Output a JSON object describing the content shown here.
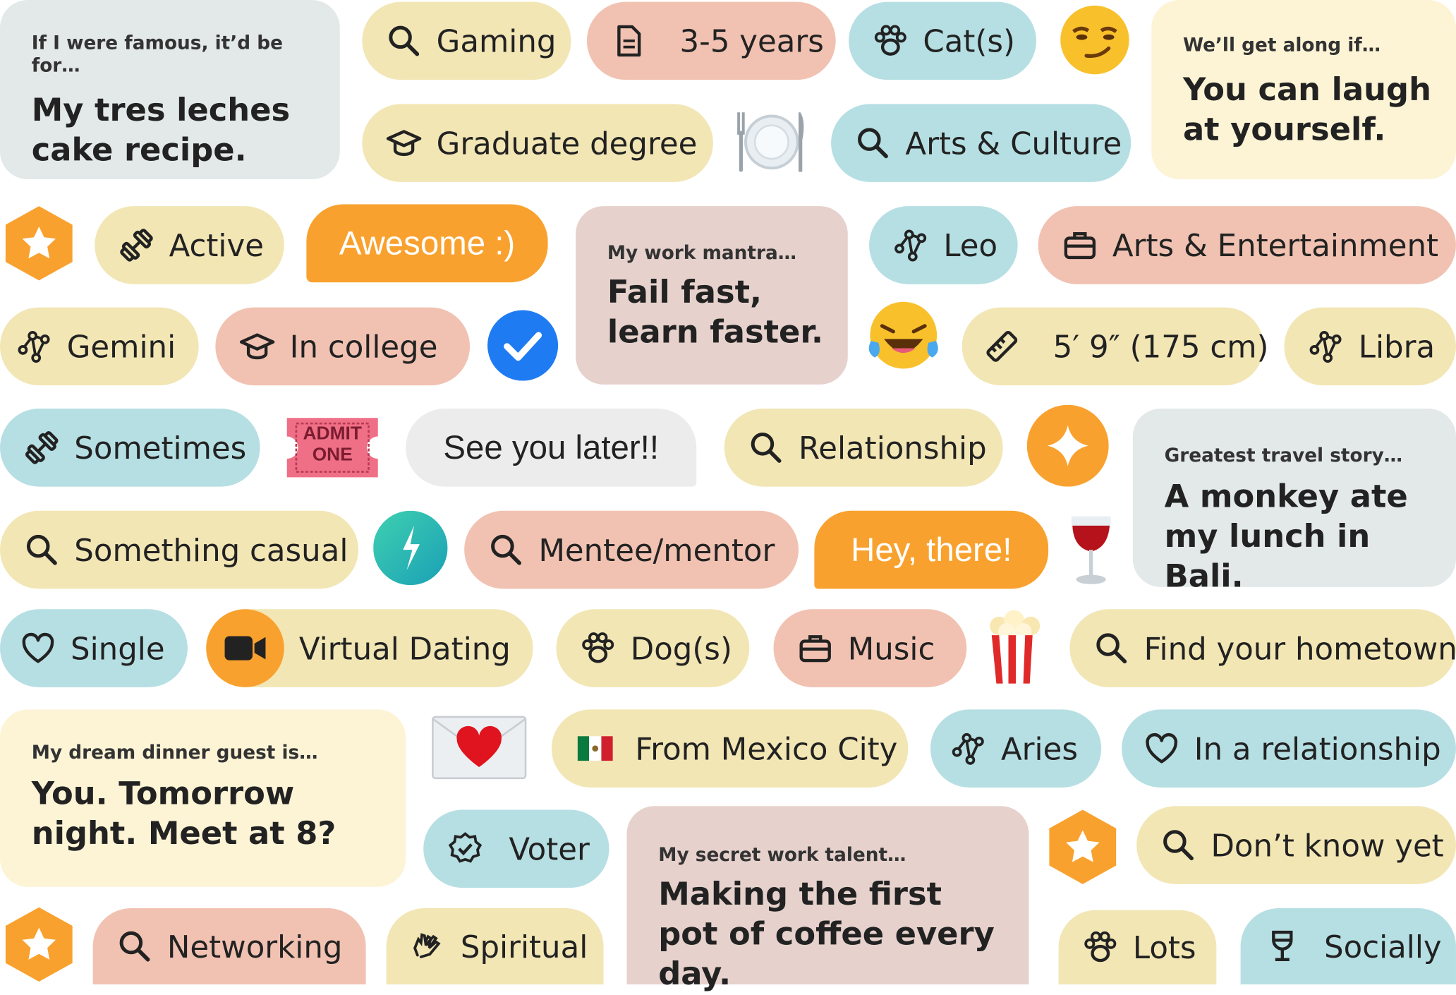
{
  "pills": {
    "gaming": "Gaming",
    "years": "3-5 years",
    "cats": "Cat(s)",
    "graduate": "Graduate degree",
    "arts_culture": "Arts & Culture",
    "active": "Active",
    "leo": "Leo",
    "arts_ent": "Arts & Entertainment",
    "gemini": "Gemini",
    "in_college": "In college",
    "height": "5′ 9″ (175 cm)",
    "libra": "Libra",
    "sometimes": "Sometimes",
    "relationship": "Relationship",
    "something_casual": "Something casual",
    "mentee": "Mentee/mentor",
    "single": "Single",
    "virtual_dating": "Virtual Dating",
    "dogs": "Dog(s)",
    "music": "Music",
    "hometown": "Find your hometown",
    "mexico": "From Mexico City",
    "aries": "Aries",
    "in_relationship": "In a relationship",
    "voter": "Voter",
    "dont_know": "Don’t know yet",
    "networking": "Networking",
    "spiritual": "Spiritual",
    "lots": "Lots",
    "socially": "Socially"
  },
  "bubbles": {
    "awesome": "Awesome :)",
    "see_you": "See you later!!",
    "hey_there": "Hey, there!"
  },
  "cards": {
    "famous": {
      "q": "If I were famous, it’d be for…",
      "a": "My tres leches cake recipe."
    },
    "get_along": {
      "q": "We’ll get along if…",
      "a": "You can laugh at yourself."
    },
    "mantra": {
      "q": "My work mantra…",
      "a": "Fail fast, learn faster."
    },
    "travel": {
      "q": "Greatest travel story…",
      "a": "A monkey ate my lunch in Bali."
    },
    "dinner": {
      "q": "My dream dinner guest is…",
      "a": "You. Tomorrow night. Meet at 8?"
    },
    "talent": {
      "q": "My secret work talent…",
      "a": "Making the first pot of coffee every day."
    }
  },
  "ticket": {
    "line1": "ADMIT",
    "line2": "ONE"
  },
  "icons": [
    "search-icon",
    "document-icon",
    "paw-icon",
    "graduation-cap-icon",
    "dumbbell-icon",
    "zodiac-icon",
    "briefcase-icon",
    "ruler-icon",
    "heart-icon",
    "video-camera-icon",
    "mexico-flag-icon",
    "verified-badge-icon",
    "hands-icon",
    "wine-glass-icon",
    "star-hexagon-icon",
    "checkmark-icon",
    "sparkle-icon",
    "bolt-icon"
  ],
  "colors": {
    "yellow": "#f2e6b5",
    "blue": "#b6dfe3",
    "pink": "#f1c2b2",
    "orange": "#f9a12e",
    "check_blue": "#1f7bf2"
  }
}
